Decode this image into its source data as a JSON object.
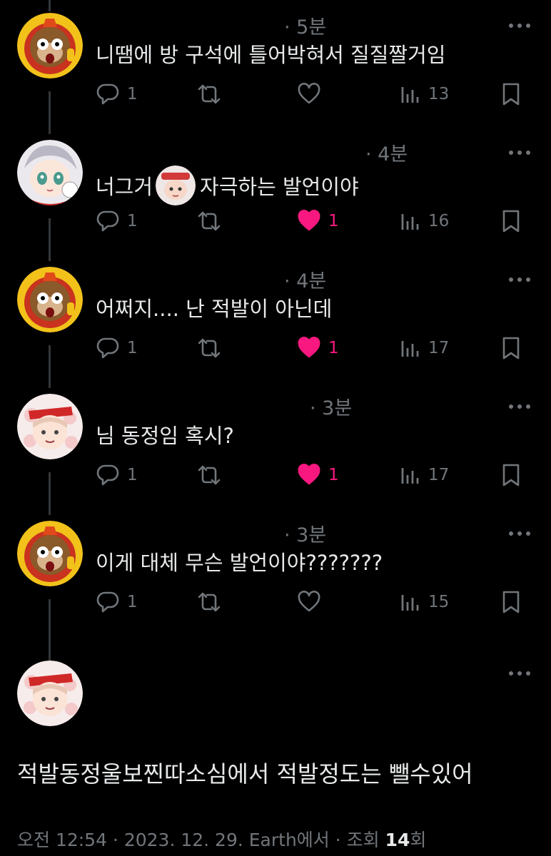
{
  "replies": [
    {
      "avatar": "peach-costume-avatar",
      "time": "· 5분",
      "text_before": "니땜에 방 구석에 틀어박혀서 질질짤거임",
      "text_after": "",
      "inline_image": false,
      "reply_count": "1",
      "like_count": "",
      "liked": false,
      "view_count": "13"
    },
    {
      "avatar": "anime-girl-avatar",
      "time": "· 4분",
      "text_before": "너그거",
      "text_after": "자극하는 발언이야",
      "inline_image": true,
      "reply_count": "1",
      "like_count": "1",
      "liked": true,
      "view_count": "16"
    },
    {
      "avatar": "peach-costume-avatar",
      "time": "· 4분",
      "text_before": "어쩌지.... 난 적발이 아닌데",
      "text_after": "",
      "inline_image": false,
      "reply_count": "1",
      "like_count": "1",
      "liked": true,
      "view_count": "17"
    },
    {
      "avatar": "red-headband-avatar",
      "time": "· 3분",
      "text_before": "님 동정임 혹시?",
      "text_after": "",
      "inline_image": false,
      "reply_count": "1",
      "like_count": "1",
      "liked": true,
      "view_count": "17"
    },
    {
      "avatar": "peach-costume-avatar",
      "time": "· 3분",
      "text_before": "이게 대체 무슨 발언이야???????",
      "text_after": "",
      "inline_image": false,
      "reply_count": "1",
      "like_count": "",
      "liked": false,
      "view_count": "15"
    }
  ],
  "main_post": {
    "avatar": "red-headband-avatar",
    "text": "적발동정울보찐따소심에서 적발정도는 뺄수있어",
    "meta_prefix": "오전 12:54 · 2023. 12. 29. Earth에서 · 조회 ",
    "view_count": "14",
    "view_suffix": "회"
  },
  "colors": {
    "background": "#000000",
    "text": "#e7e9ea",
    "muted": "#71767b",
    "like": "#f91880",
    "thread_line": "#333639"
  }
}
